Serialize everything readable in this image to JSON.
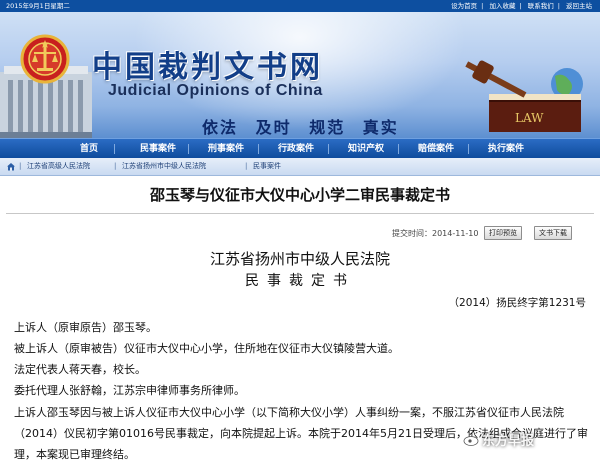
{
  "topbar": {
    "date": "2015年9月1日星期二",
    "links": [
      "设为首页",
      "加入收藏",
      "联系我们",
      "返回主站"
    ]
  },
  "banner": {
    "title_cn": "中国裁判文书网",
    "title_en": "Judicial Opinions of China",
    "slogan": [
      "依法",
      "及时",
      "规范",
      "真实"
    ],
    "book_label": "LAW"
  },
  "nav": {
    "items": [
      "首页",
      "民事案件",
      "刑事案件",
      "行政案件",
      "知识产权",
      "赔偿案件",
      "执行案件"
    ]
  },
  "breadcrumb": [
    "江苏省高级人民法院",
    "江苏省扬州市中级人民法院",
    "民事案件"
  ],
  "document": {
    "title": "邵玉琴与仪征市大仪中心小学二审民事裁定书",
    "submit_label": "提交时间：2014-11-10",
    "print_button": "打印预览",
    "download_button": "文书下载",
    "court": "江苏省扬州市中级人民法院",
    "doc_type": "民事裁定书",
    "case_number": "（2014）扬民终字第1231号",
    "paragraphs": [
      "上诉人（原审原告）邵玉琴。",
      "被上诉人（原审被告）仪征市大仪中心小学，住所地在仪征市大仪镇陵营大道。",
      "法定代表人蒋天春，校长。",
      "委托代理人张舒翰，江苏宗申律师事务所律师。"
    ],
    "body": "上诉人邵玉琴因与被上诉人仪征市大仪中心小学（以下简称大仪小学）人事纠纷一案，不服江苏省仪征市人民法院（2014）仪民初字第01016号民事裁定，向本院提起上诉。本院于2014年5月21日受理后，依法组成合议庭进行了审理，本案现已审理终结。"
  },
  "watermark": "东方早报"
}
